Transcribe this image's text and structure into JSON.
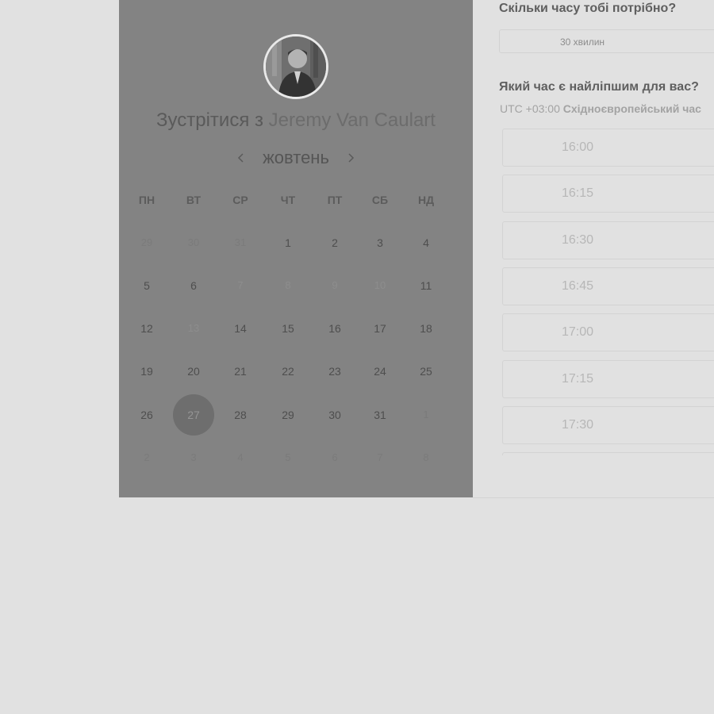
{
  "host": {
    "title_prefix": "Зустрітися з",
    "name": "Jeremy Van Caulart",
    "avatar_icon": "person-avatar"
  },
  "calendar": {
    "month": "жовтень",
    "prev_icon": "chevron-left-icon",
    "next_icon": "chevron-right-icon",
    "weekdays": [
      "ПН",
      "ВТ",
      "СР",
      "ЧТ",
      "ПТ",
      "СБ",
      "НД"
    ],
    "weeks": [
      [
        {
          "d": "29",
          "s": "off"
        },
        {
          "d": "30",
          "s": "off"
        },
        {
          "d": "31",
          "s": "off"
        },
        {
          "d": "1",
          "s": "avail"
        },
        {
          "d": "2",
          "s": "avail"
        },
        {
          "d": "3",
          "s": "avail"
        },
        {
          "d": "4",
          "s": "avail"
        }
      ],
      [
        {
          "d": "5",
          "s": "avail"
        },
        {
          "d": "6",
          "s": "avail"
        },
        {
          "d": "7",
          "s": "dim"
        },
        {
          "d": "8",
          "s": "dim"
        },
        {
          "d": "9",
          "s": "dim"
        },
        {
          "d": "10",
          "s": "dim"
        },
        {
          "d": "11",
          "s": "avail"
        }
      ],
      [
        {
          "d": "12",
          "s": "avail"
        },
        {
          "d": "13",
          "s": "dim"
        },
        {
          "d": "14",
          "s": "avail"
        },
        {
          "d": "15",
          "s": "avail"
        },
        {
          "d": "16",
          "s": "avail"
        },
        {
          "d": "17",
          "s": "avail"
        },
        {
          "d": "18",
          "s": "avail"
        }
      ],
      [
        {
          "d": "19",
          "s": "avail"
        },
        {
          "d": "20",
          "s": "avail"
        },
        {
          "d": "21",
          "s": "avail"
        },
        {
          "d": "22",
          "s": "avail"
        },
        {
          "d": "23",
          "s": "avail"
        },
        {
          "d": "24",
          "s": "avail"
        },
        {
          "d": "25",
          "s": "avail"
        }
      ],
      [
        {
          "d": "26",
          "s": "avail"
        },
        {
          "d": "27",
          "s": "selected"
        },
        {
          "d": "28",
          "s": "avail"
        },
        {
          "d": "29",
          "s": "avail"
        },
        {
          "d": "30",
          "s": "avail"
        },
        {
          "d": "31",
          "s": "avail"
        },
        {
          "d": "1",
          "s": "off"
        }
      ],
      [
        {
          "d": "2",
          "s": "off"
        },
        {
          "d": "3",
          "s": "off"
        },
        {
          "d": "4",
          "s": "off"
        },
        {
          "d": "5",
          "s": "off"
        },
        {
          "d": "6",
          "s": "off"
        },
        {
          "d": "7",
          "s": "off"
        },
        {
          "d": "8",
          "s": "off"
        }
      ]
    ],
    "selected_day": "27"
  },
  "duration": {
    "question": "Скільки часу тобі потрібно?",
    "value": "30 хвилин"
  },
  "time": {
    "question": "Який час є найліпшим для вас?",
    "tz_offset": "UTC +03:00",
    "tz_name": "Східноєвропейський час",
    "slots": [
      "16:00",
      "16:15",
      "16:30",
      "16:45",
      "17:00",
      "17:15",
      "17:30",
      ""
    ]
  },
  "colors": {
    "overlay_panel": "#838383",
    "page_background": "#e1e1e1",
    "selected_day": "#6e6e6e"
  }
}
